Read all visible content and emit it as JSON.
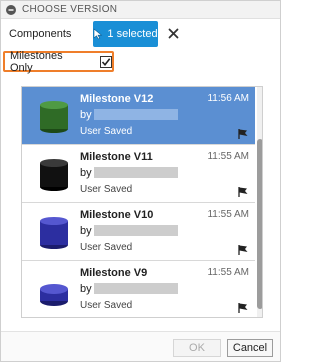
{
  "titlebar": {
    "title": "CHOOSE VERSION"
  },
  "components": {
    "label": "Components",
    "select_label": "1 selected"
  },
  "milestones": {
    "label": "Milestones Only",
    "checked": true
  },
  "versions": [
    {
      "name": "Milestone V12",
      "time": "11:56 AM",
      "by": "by",
      "desc": "User Saved",
      "selected": true,
      "color": "#2f6b26"
    },
    {
      "name": "Milestone V11",
      "time": "11:55 AM",
      "by": "by",
      "desc": "User Saved",
      "selected": false,
      "color": "#111111"
    },
    {
      "name": "Milestone V10",
      "time": "11:55 AM",
      "by": "by",
      "desc": "User Saved",
      "selected": false,
      "color": "#2c2ea0"
    },
    {
      "name": "Milestone V9",
      "time": "11:55 AM",
      "by": "by",
      "desc": "User Saved",
      "selected": false,
      "color": "#2c2ea0"
    }
  ],
  "footer": {
    "ok_label": "OK",
    "cancel_label": "Cancel"
  },
  "colors": {
    "accent": "#1a8fd6",
    "highlight": "#ef7e2a",
    "selected_row": "#5b8fd2"
  }
}
